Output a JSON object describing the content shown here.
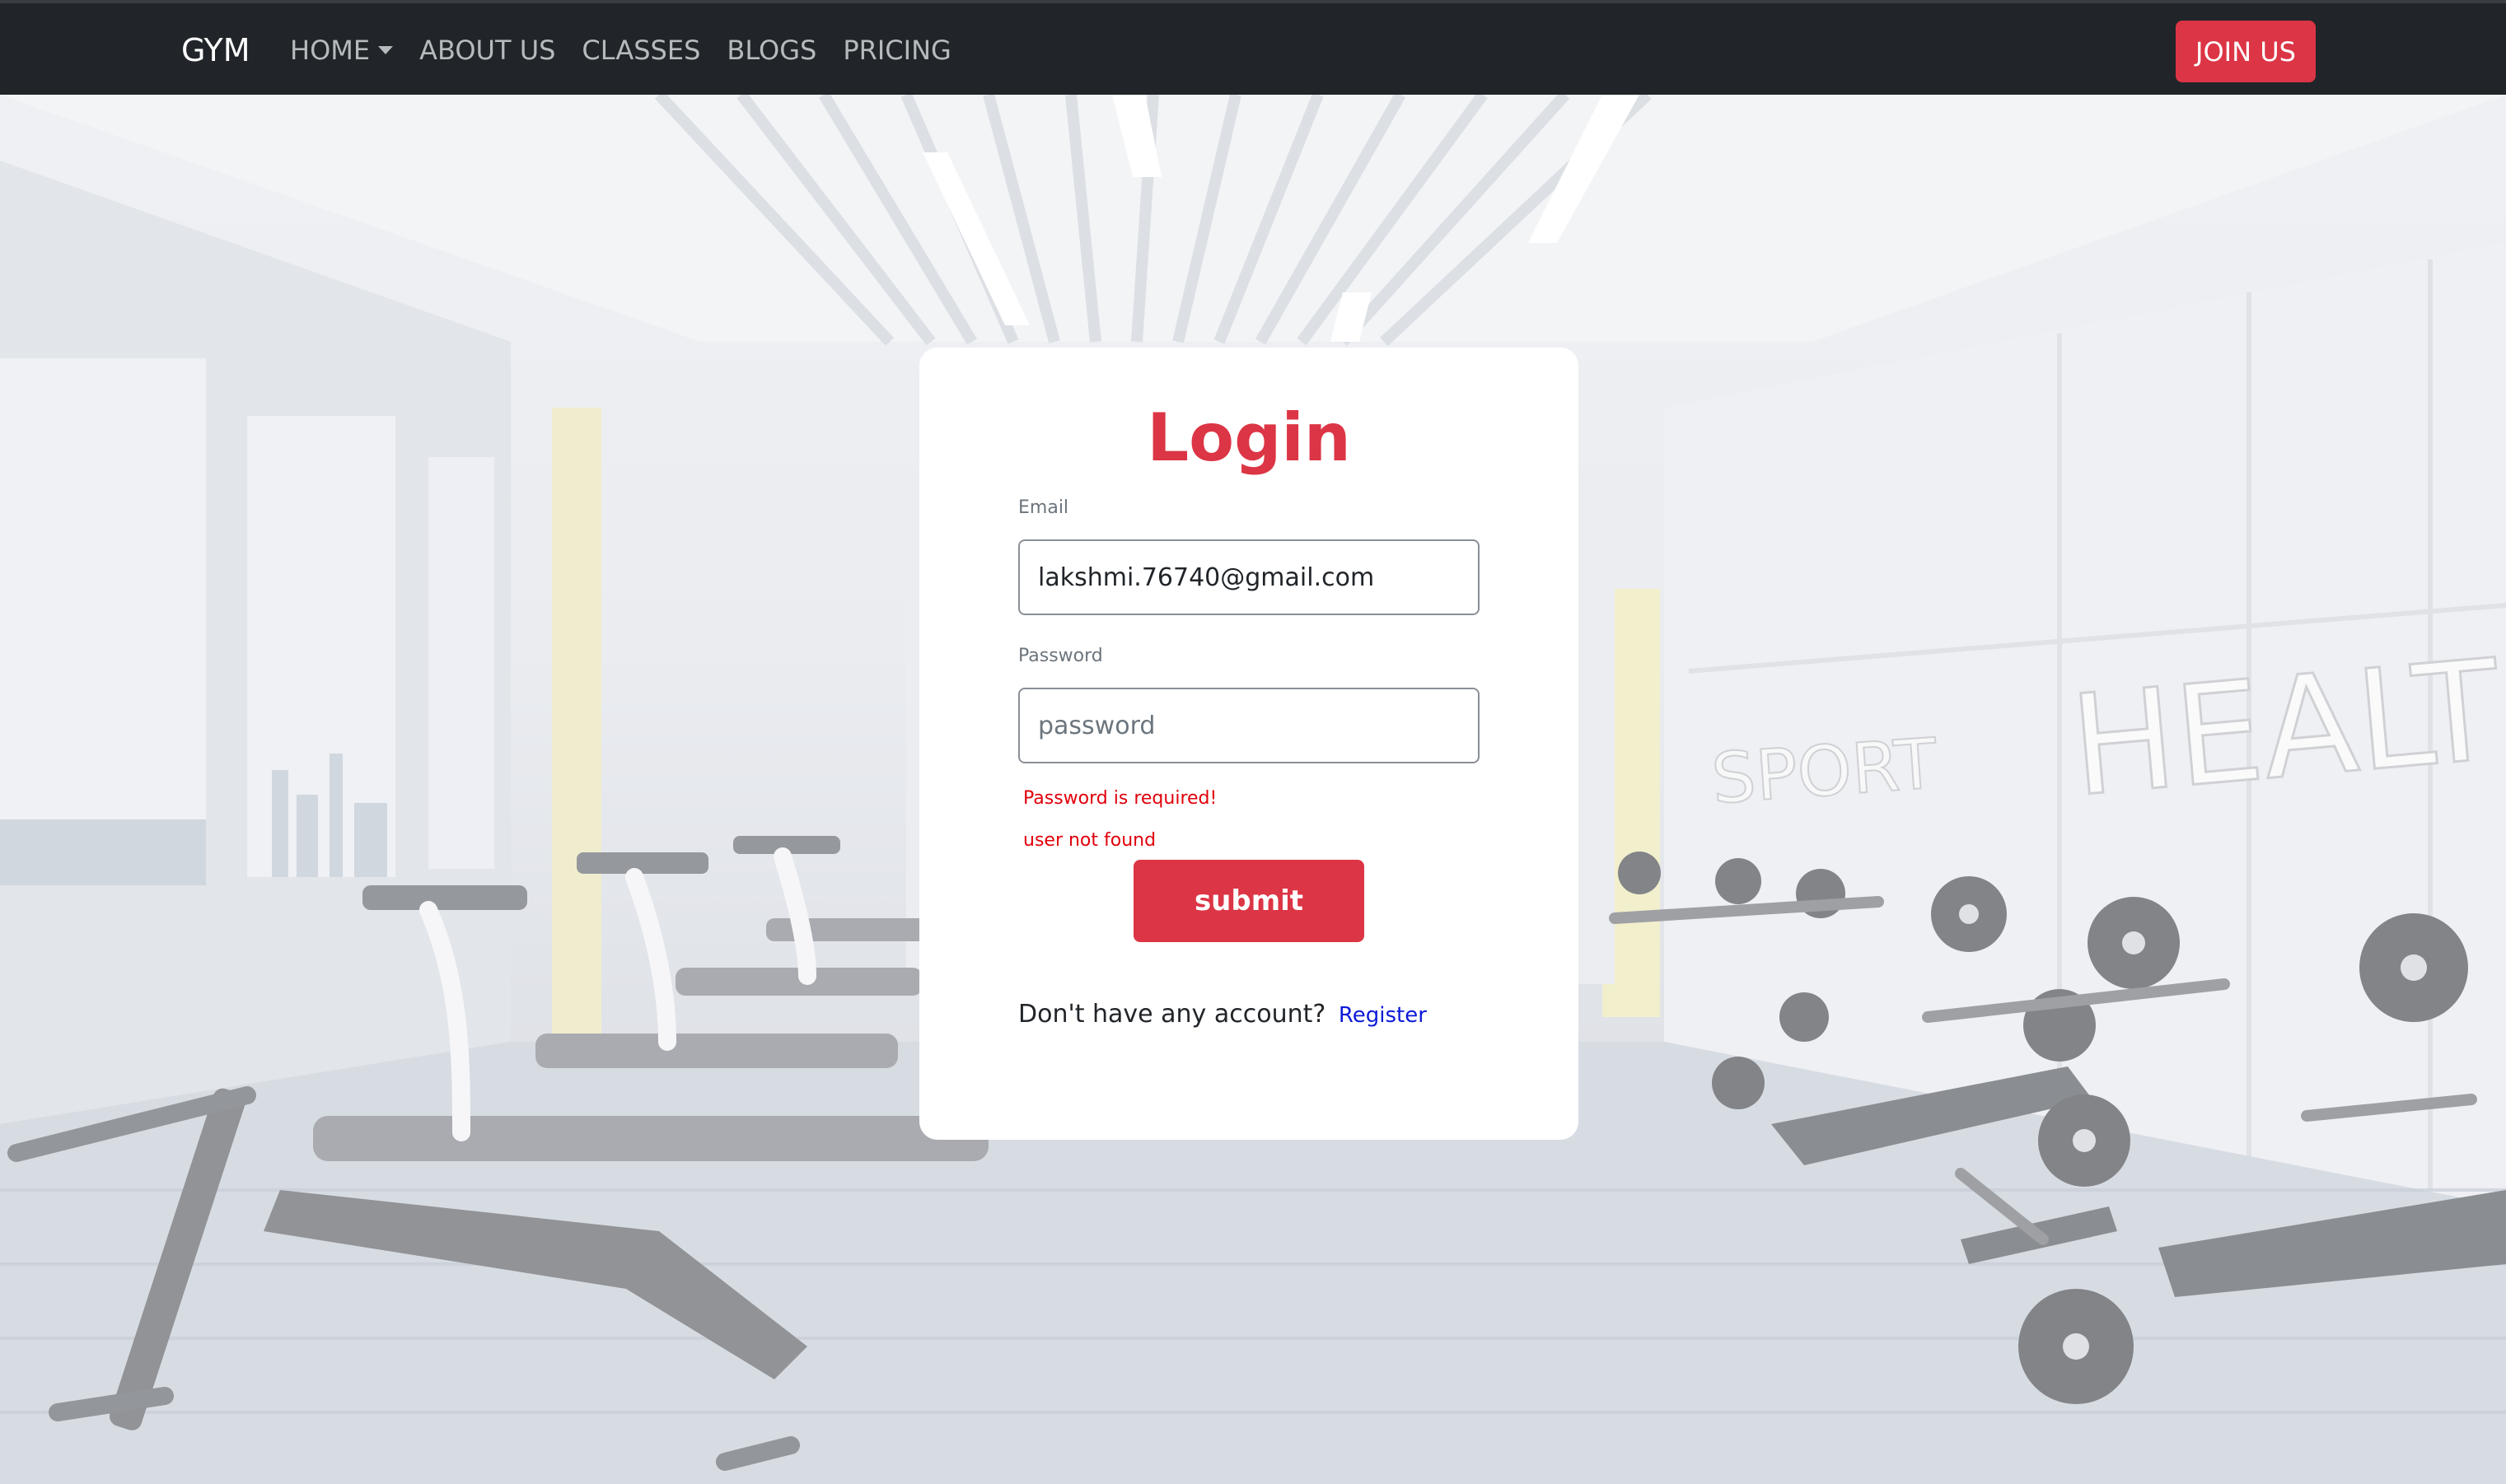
{
  "navbar": {
    "brand": "GYM",
    "links": [
      {
        "label": "HOME",
        "has_dropdown": true
      },
      {
        "label": "ABOUT US"
      },
      {
        "label": "CLASSES"
      },
      {
        "label": "BLOGS"
      },
      {
        "label": "PRICING"
      }
    ],
    "join_button": "JOIN US"
  },
  "background": {
    "wall_signs": [
      "SPORT",
      "HEALTH"
    ]
  },
  "login": {
    "title": "Login",
    "email": {
      "label": "Email",
      "value": "lakshmi.76740@gmail.com"
    },
    "password": {
      "label": "Password",
      "placeholder": "password",
      "value": ""
    },
    "errors": [
      "Password is required!",
      "user not found"
    ],
    "submit_label": "submit",
    "account_prompt": "Don't have any account?",
    "register_link": "Register"
  },
  "colors": {
    "navbar_bg": "#212529",
    "accent": "#dc3545",
    "error": "#e0000b",
    "link": "#0d1ad8"
  }
}
